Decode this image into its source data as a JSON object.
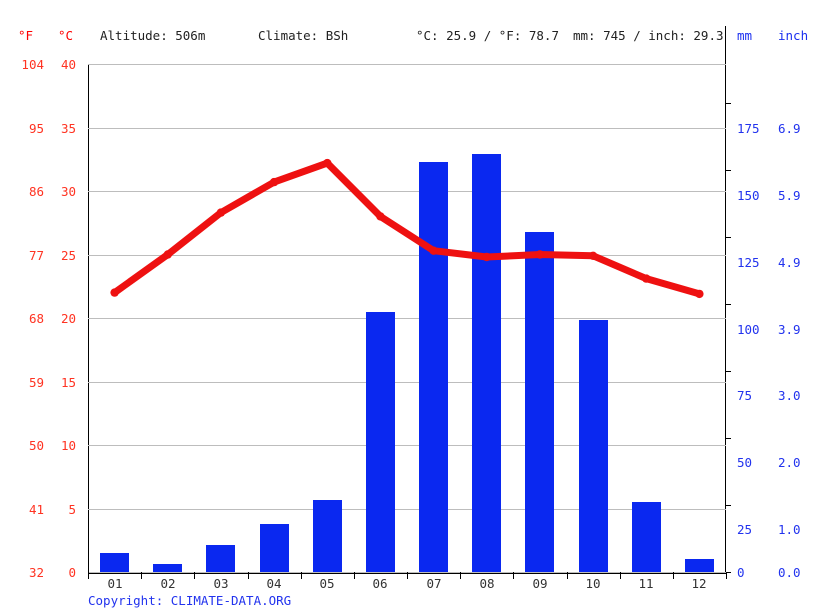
{
  "header": {
    "f_unit": "°F",
    "c_unit": "°C",
    "altitude": "Altitude: 506m",
    "climate": "Climate: BSh",
    "temperature": "°C: 25.9 / °F: 78.7",
    "precipitation": "mm: 745 / inch: 29.3",
    "mm_unit": "mm",
    "inch_unit": "inch"
  },
  "footer": {
    "copyright": "Copyright: CLIMATE-DATA.ORG"
  },
  "axes": {
    "fahrenheit_ticks": [
      "104",
      "95",
      "86",
      "77",
      "68",
      "59",
      "50",
      "41",
      "32"
    ],
    "celsius_ticks": [
      "40",
      "35",
      "30",
      "25",
      "20",
      "15",
      "10",
      "5",
      "0"
    ],
    "mm_ticks": [
      "175",
      "150",
      "125",
      "100",
      "75",
      "50",
      "25",
      "0"
    ],
    "inch_ticks": [
      "6.9",
      "5.9",
      "4.9",
      "3.9",
      "3.0",
      "2.0",
      "1.0",
      "0.0"
    ]
  },
  "colors": {
    "temperature_line": "#ee1111",
    "precipitation_bar": "#0a28f0",
    "left_axis_text": "#ff3322",
    "right_axis_text": "#2233ee",
    "gridline": "#bdbdbd"
  },
  "chart_data": {
    "type": "bar",
    "title": "",
    "subtitle": "",
    "xlabel": "",
    "ylabel": "",
    "grid": true,
    "legend_position": "none",
    "categories": [
      "01",
      "02",
      "03",
      "04",
      "05",
      "06",
      "07",
      "08",
      "09",
      "10",
      "11",
      "12"
    ],
    "annotations": [
      "Altitude: 506m",
      "Climate: BSh",
      "°C: 25.9 / °F: 78.7",
      "mm: 745 / inch: 29.3",
      "Copyright: CLIMATE-DATA.ORG"
    ],
    "series": [
      {
        "name": "Precipitation",
        "type": "bar",
        "unit": "mm",
        "axis": "right",
        "color": "#0a28f0",
        "ylim": [
          0,
          190
        ],
        "values": [
          7,
          3,
          10,
          18,
          27,
          97,
          153,
          156,
          127,
          94,
          26,
          5
        ]
      },
      {
        "name": "Average Temperature",
        "type": "line",
        "unit": "°C",
        "axis": "left",
        "color": "#ee1111",
        "ylim": [
          0,
          40
        ],
        "values": [
          22.0,
          25.0,
          28.3,
          30.7,
          32.2,
          28.0,
          25.3,
          24.8,
          25.0,
          24.9,
          23.1,
          21.9
        ]
      }
    ]
  }
}
